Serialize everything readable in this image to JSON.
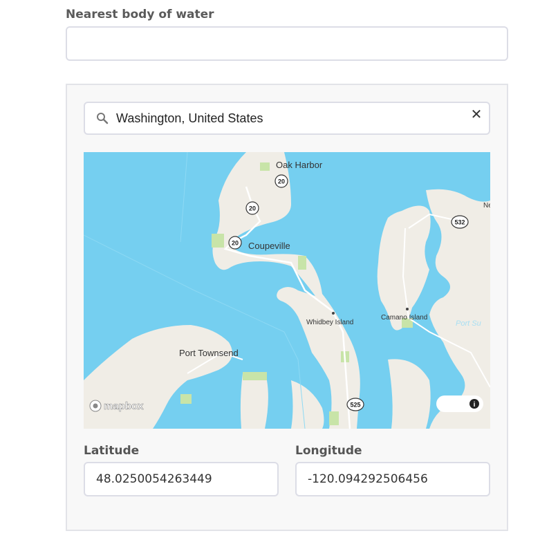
{
  "form": {
    "water_label": "Nearest body of water",
    "water_value": ""
  },
  "search": {
    "value": "Washington, United States",
    "clear_glyph": "✕",
    "icon": "search-icon"
  },
  "map": {
    "provider": "mapbox",
    "places": {
      "oak_harbor": "Oak Harbor",
      "coupeville": "Coupeville",
      "whidbey_island": "Whidbey Island",
      "camano_island": "Camano Island",
      "port_townsend": "Port Townsend",
      "port_su": "Port Su",
      "ne": "Ne"
    },
    "routes": {
      "r20a": "20",
      "r20b": "20",
      "r20c": "20",
      "r532": "532",
      "r525": "525"
    },
    "info_icon": "info-icon",
    "colors": {
      "water": "#75cff0",
      "land": "#f0ede6",
      "park": "#c8e4a8"
    }
  },
  "coords": {
    "lat_label": "Latitude",
    "lng_label": "Longitude",
    "lat_value": "48.0250054263449",
    "lng_value": "-120.094292506456"
  }
}
